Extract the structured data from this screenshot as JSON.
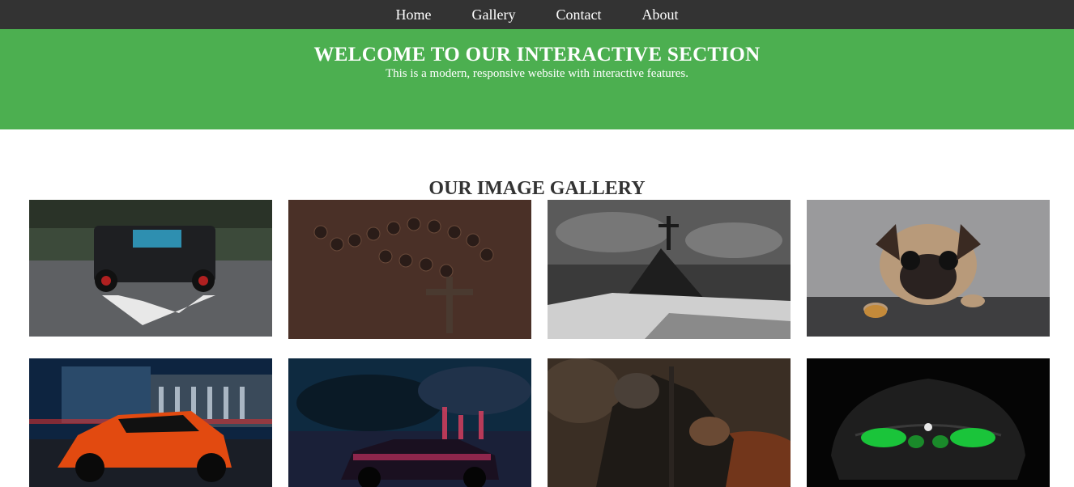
{
  "nav": {
    "items": [
      {
        "label": "Home"
      },
      {
        "label": "Gallery"
      },
      {
        "label": "Contact"
      },
      {
        "label": "About"
      }
    ]
  },
  "hero": {
    "title": "WELCOME TO OUR INTERACTIVE SECTION",
    "subtitle": "This is a modern, responsive website with interactive features."
  },
  "gallery": {
    "title": "OUR IMAGE GALLERY",
    "images": [
      {
        "subject": "black-suv"
      },
      {
        "subject": "rosary"
      },
      {
        "subject": "cross-on-mountain"
      },
      {
        "subject": "pug-dog"
      },
      {
        "subject": "orange-sports-car"
      },
      {
        "subject": "muscle-car-neon-city"
      },
      {
        "subject": "dark-knight"
      },
      {
        "subject": "green-headlight-car"
      }
    ]
  },
  "colors": {
    "nav_bg": "#333333",
    "hero_bg": "#4caf50",
    "text": "#333333"
  }
}
